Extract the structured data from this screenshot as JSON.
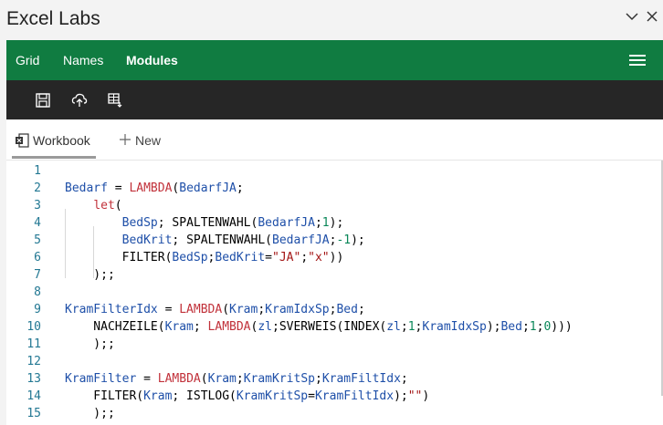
{
  "window": {
    "title": "Excel Labs"
  },
  "nav": {
    "tabs": [
      "Grid",
      "Names",
      "Modules"
    ],
    "active": "Modules"
  },
  "toolbar": {
    "buttons": [
      "save-icon",
      "cloud-upload-icon",
      "table-insert-icon"
    ]
  },
  "doc_tabs": {
    "workbook": "Workbook",
    "new": "New"
  },
  "colors": {
    "nav_bg": "#107c41",
    "toolbar_bg": "#262626",
    "variable": "#1e4fa8",
    "function": "#c1313a",
    "string": "#a31515",
    "number": "#098658"
  },
  "code": {
    "lines": [
      [],
      [
        [
          "v",
          "Bedarf"
        ],
        [
          "p",
          " = "
        ],
        [
          "f",
          "LAMBDA"
        ],
        [
          "p",
          "("
        ],
        [
          "v",
          "BedarfJA"
        ],
        [
          "p",
          ";"
        ]
      ],
      [
        [
          "p",
          "    "
        ],
        [
          "f",
          "let"
        ],
        [
          "p",
          "("
        ]
      ],
      [
        [
          "p",
          "        "
        ],
        [
          "v",
          "BedSp"
        ],
        [
          "p",
          "; SPALTENWAHL("
        ],
        [
          "v",
          "BedarfJA"
        ],
        [
          "p",
          ";"
        ],
        [
          "n",
          "1"
        ],
        [
          "p",
          ");"
        ]
      ],
      [
        [
          "p",
          "        "
        ],
        [
          "v",
          "BedKrit"
        ],
        [
          "p",
          "; SPALTENWAHL("
        ],
        [
          "v",
          "BedarfJA"
        ],
        [
          "p",
          ";"
        ],
        [
          "n",
          "-1"
        ],
        [
          "p",
          ");"
        ]
      ],
      [
        [
          "p",
          "        FILTER("
        ],
        [
          "v",
          "BedSp"
        ],
        [
          "p",
          ";"
        ],
        [
          "v",
          "BedKrit"
        ],
        [
          "p",
          "="
        ],
        [
          "s",
          "\"JA\""
        ],
        [
          "p",
          ";"
        ],
        [
          "s",
          "\"x\""
        ],
        [
          "p",
          "))"
        ]
      ],
      [
        [
          "p",
          "    );;"
        ]
      ],
      [],
      [
        [
          "v",
          "KramFilterIdx"
        ],
        [
          "p",
          " = "
        ],
        [
          "f",
          "LAMBDA"
        ],
        [
          "p",
          "("
        ],
        [
          "v",
          "Kram"
        ],
        [
          "p",
          ";"
        ],
        [
          "v",
          "KramIdxSp"
        ],
        [
          "p",
          ";"
        ],
        [
          "v",
          "Bed"
        ],
        [
          "p",
          ";"
        ]
      ],
      [
        [
          "p",
          "    NACHZEILE("
        ],
        [
          "v",
          "Kram"
        ],
        [
          "p",
          "; "
        ],
        [
          "f",
          "LAMBDA"
        ],
        [
          "p",
          "("
        ],
        [
          "v",
          "zl"
        ],
        [
          "p",
          ";SVERWEIS(INDEX("
        ],
        [
          "v",
          "zl"
        ],
        [
          "p",
          ";"
        ],
        [
          "n",
          "1"
        ],
        [
          "p",
          ";"
        ],
        [
          "v",
          "KramIdxSp"
        ],
        [
          "p",
          ");"
        ],
        [
          "v",
          "Bed"
        ],
        [
          "p",
          ";"
        ],
        [
          "n",
          "1"
        ],
        [
          "p",
          ";"
        ],
        [
          "n",
          "0"
        ],
        [
          "p",
          ")))"
        ]
      ],
      [
        [
          "p",
          "    );;"
        ]
      ],
      [],
      [
        [
          "v",
          "KramFilter"
        ],
        [
          "p",
          " = "
        ],
        [
          "f",
          "LAMBDA"
        ],
        [
          "p",
          "("
        ],
        [
          "v",
          "Kram"
        ],
        [
          "p",
          ";"
        ],
        [
          "v",
          "KramKritSp"
        ],
        [
          "p",
          ";"
        ],
        [
          "v",
          "KramFiltIdx"
        ],
        [
          "p",
          ";"
        ]
      ],
      [
        [
          "p",
          "    FILTER("
        ],
        [
          "v",
          "Kram"
        ],
        [
          "p",
          "; ISTLOG("
        ],
        [
          "v",
          "KramKritSp"
        ],
        [
          "p",
          "="
        ],
        [
          "v",
          "KramFiltIdx"
        ],
        [
          "p",
          ");"
        ],
        [
          "s",
          "\"\""
        ],
        [
          "p",
          ")"
        ]
      ],
      [
        [
          "p",
          "    );;"
        ]
      ]
    ]
  }
}
